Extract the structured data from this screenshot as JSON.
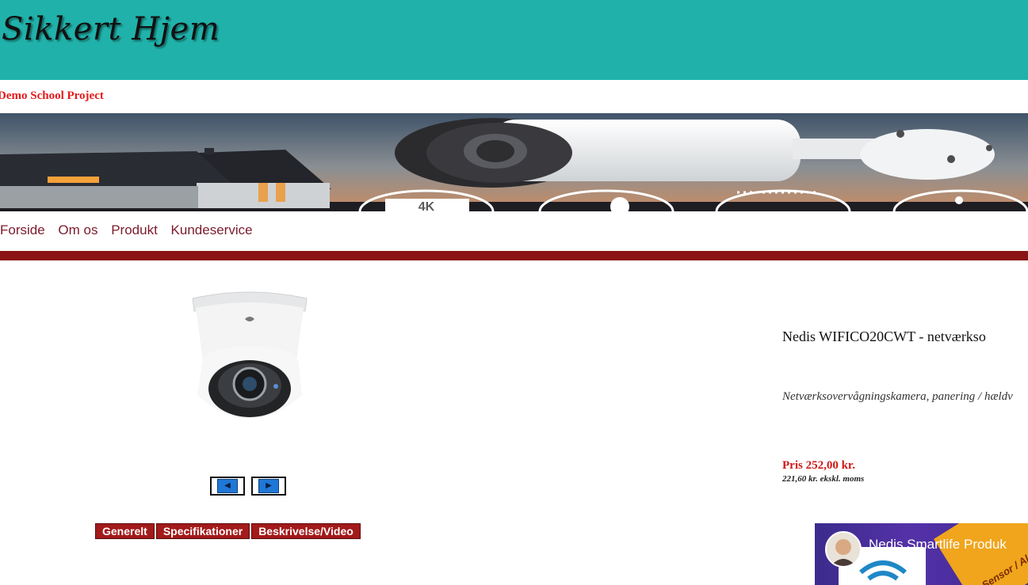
{
  "header": {
    "site_title": "Sikkert Hjem",
    "demo_label": "Demo School Project"
  },
  "banner": {
    "badge_4k": "4K"
  },
  "nav": {
    "items": [
      "Forside",
      "Om os",
      "Produkt",
      "Kundeservice"
    ]
  },
  "product": {
    "title": "Nedis WIFICO20CWT - netværkso",
    "subtitle": "Netværksovervågningskamera, panering / hældv",
    "price": "Pris 252,00 kr.",
    "price_ex_vat": "221,60 kr. ekskl. moms"
  },
  "gallery": {
    "prev_icon": "◀",
    "next_icon": "▶"
  },
  "tabs": [
    "Generelt",
    "Specifikationer",
    "Beskrivelse/Video"
  ],
  "video": {
    "title": "Nedis Smartlife Produk",
    "overlay_text": "ion Sensor / Alarm......"
  },
  "colors": {
    "header_bg": "#20b2aa",
    "nav_bar": "#8b1313",
    "nav_link": "#7b1b2c",
    "price": "#d11818",
    "tab_bg": "#a31a1a"
  }
}
